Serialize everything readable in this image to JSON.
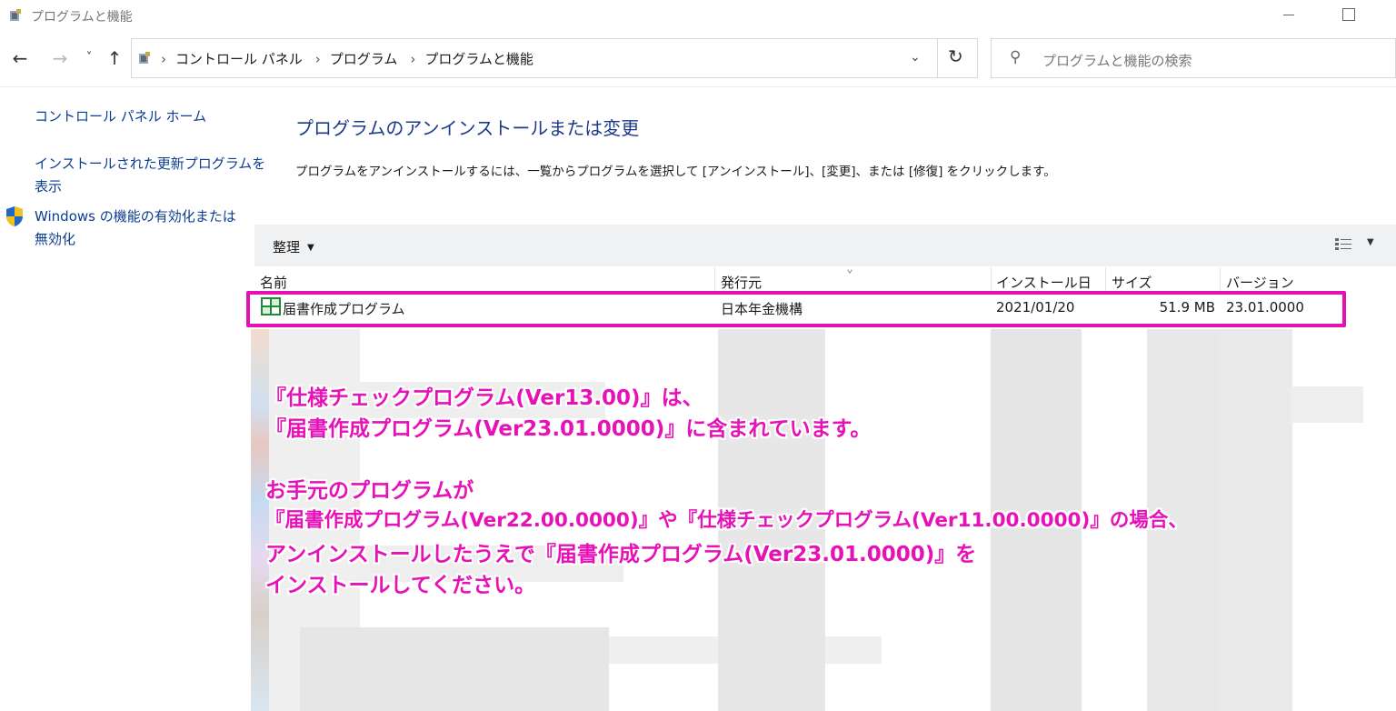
{
  "window": {
    "title": "プログラムと機能"
  },
  "nav": {
    "back": "←",
    "forward": "→",
    "recent": "˅",
    "up": "↑",
    "breadcrumb": [
      "コントロール パネル",
      "プログラム",
      "プログラムと機能"
    ],
    "refresh": "↻",
    "search_placeholder": "プログラムと機能の検索"
  },
  "sidebar": {
    "home": "コントロール パネル ホーム",
    "updates_line1": "インストールされた更新プログラムを",
    "updates_line2": "表示",
    "features_line1": "Windows の機能の有効化または",
    "features_line2": "無効化"
  },
  "main": {
    "heading": "プログラムのアンインストールまたは変更",
    "instruction": "プログラムをアンインストールするには、一覧からプログラムを選択して [アンインストール]、[変更]、または [修復] をクリックします。",
    "organize": "整理"
  },
  "table": {
    "columns": [
      "名前",
      "発行元",
      "インストール日",
      "サイズ",
      "バージョン"
    ],
    "rows": [
      {
        "name": "届書作成プログラム",
        "publisher": "日本年金機構",
        "installed": "2021/01/20",
        "size": "51.9 MB",
        "version": "23.01.0000"
      }
    ]
  },
  "annotation": {
    "lines": [
      "『仕様チェックプログラム(Ver13.00)』は、",
      "『届書作成プログラム(Ver23.01.0000)』に含まれています。",
      "お手元のプログラムが",
      "『届書作成プログラム(Ver22.00.0000)』や『仕様チェックプログラム(Ver11.00.0000)』の場合、",
      "アンインストールしたうえで『届書作成プログラム(Ver23.01.0000)』を",
      "インストールしてください。"
    ],
    "color": "#e612b8"
  },
  "colors": {
    "highlight": "#e60fb4",
    "link": "#0b3d91",
    "heading": "#1d3a8a"
  }
}
